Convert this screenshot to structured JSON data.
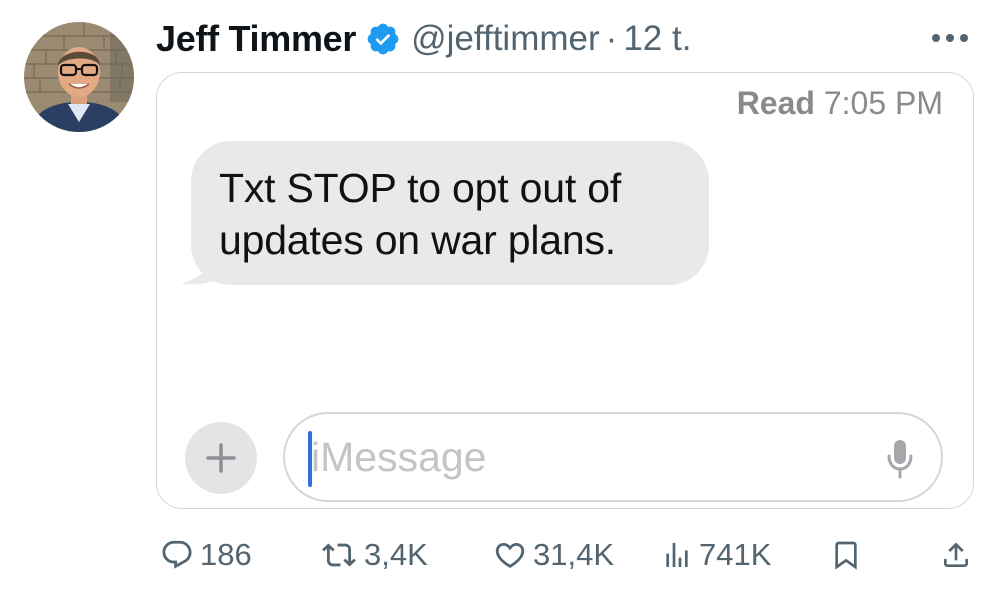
{
  "post": {
    "author": {
      "display_name": "Jeff Timmer",
      "handle": "@jefftimmer",
      "verified": true,
      "verified_color": "#1d9bf0"
    },
    "time_separator": "·",
    "relative_time": "12 t.",
    "more_icon": "ellipsis-horizontal-icon"
  },
  "imessage": {
    "read_label": "Read",
    "read_time": "7:05 PM",
    "bubble_line_1": "Txt STOP to opt out of",
    "bubble_line_2": "updates on war plans.",
    "input_placeholder": "iMessage",
    "add_icon": "plus-icon",
    "mic_icon": "microphone-icon",
    "caret_color": "#2f6fe0"
  },
  "actions": {
    "replies": "186",
    "reposts": "3,4K",
    "likes": "31,4K",
    "views": "741K"
  },
  "colors": {
    "text_primary": "#0f1419",
    "text_secondary": "#536471",
    "bubble_bg": "#e9e9eb"
  }
}
